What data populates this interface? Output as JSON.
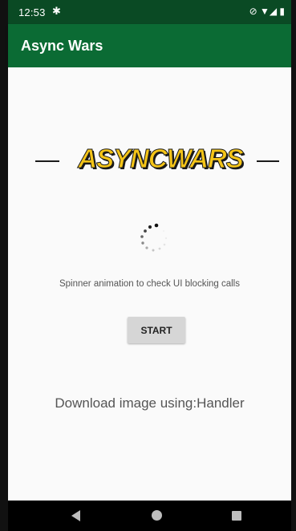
{
  "status_bar": {
    "time": "12:53",
    "settings_icon": "gear-icon",
    "right_icons": "⊘ ▼◢ ▮"
  },
  "app_bar": {
    "title": "Async Wars"
  },
  "logo": {
    "text": "ASYNCWARS",
    "color": "#f5c518"
  },
  "spinner": {
    "icon": "loading-spinner-icon"
  },
  "main": {
    "caption": "Spinner animation to check UI blocking calls",
    "start_label": "START",
    "download_text": "Download image using:Handler"
  },
  "nav_bar": {
    "back": "back-icon",
    "home": "home-icon",
    "recents": "recents-icon"
  },
  "colors": {
    "status_bar": "#0a4a24",
    "app_bar": "#0b6b34",
    "button": "#d6d6d6"
  }
}
